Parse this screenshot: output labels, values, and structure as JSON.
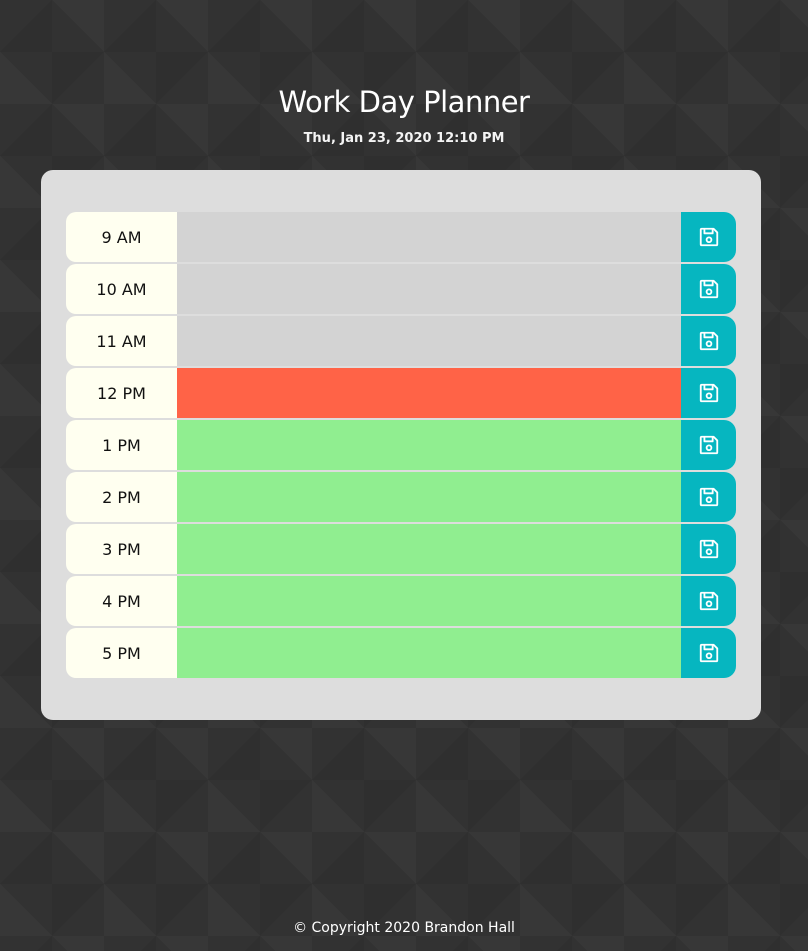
{
  "header": {
    "title": "Work Day Planner",
    "date": "Thu, Jan 23, 2020 12:10 PM"
  },
  "rows": [
    {
      "hour": "9 AM",
      "status": "past",
      "text": ""
    },
    {
      "hour": "10 AM",
      "status": "past",
      "text": ""
    },
    {
      "hour": "11 AM",
      "status": "past",
      "text": ""
    },
    {
      "hour": "12 PM",
      "status": "present",
      "text": ""
    },
    {
      "hour": "1 PM",
      "status": "future",
      "text": ""
    },
    {
      "hour": "2 PM",
      "status": "future",
      "text": ""
    },
    {
      "hour": "3 PM",
      "status": "future",
      "text": ""
    },
    {
      "hour": "4 PM",
      "status": "future",
      "text": ""
    },
    {
      "hour": "5 PM",
      "status": "future",
      "text": ""
    }
  ],
  "icons": {
    "save": "floppy-disk-icon"
  },
  "colors": {
    "past": "#d3d3d3",
    "present": "#ff6347",
    "future": "#90ee90",
    "save_button": "#06b6c0",
    "hour_label_bg": "#fffff0",
    "panel": "#dddddd",
    "background": "#323232"
  },
  "footer": {
    "copyright": "© Copyright 2020 Brandon Hall"
  }
}
